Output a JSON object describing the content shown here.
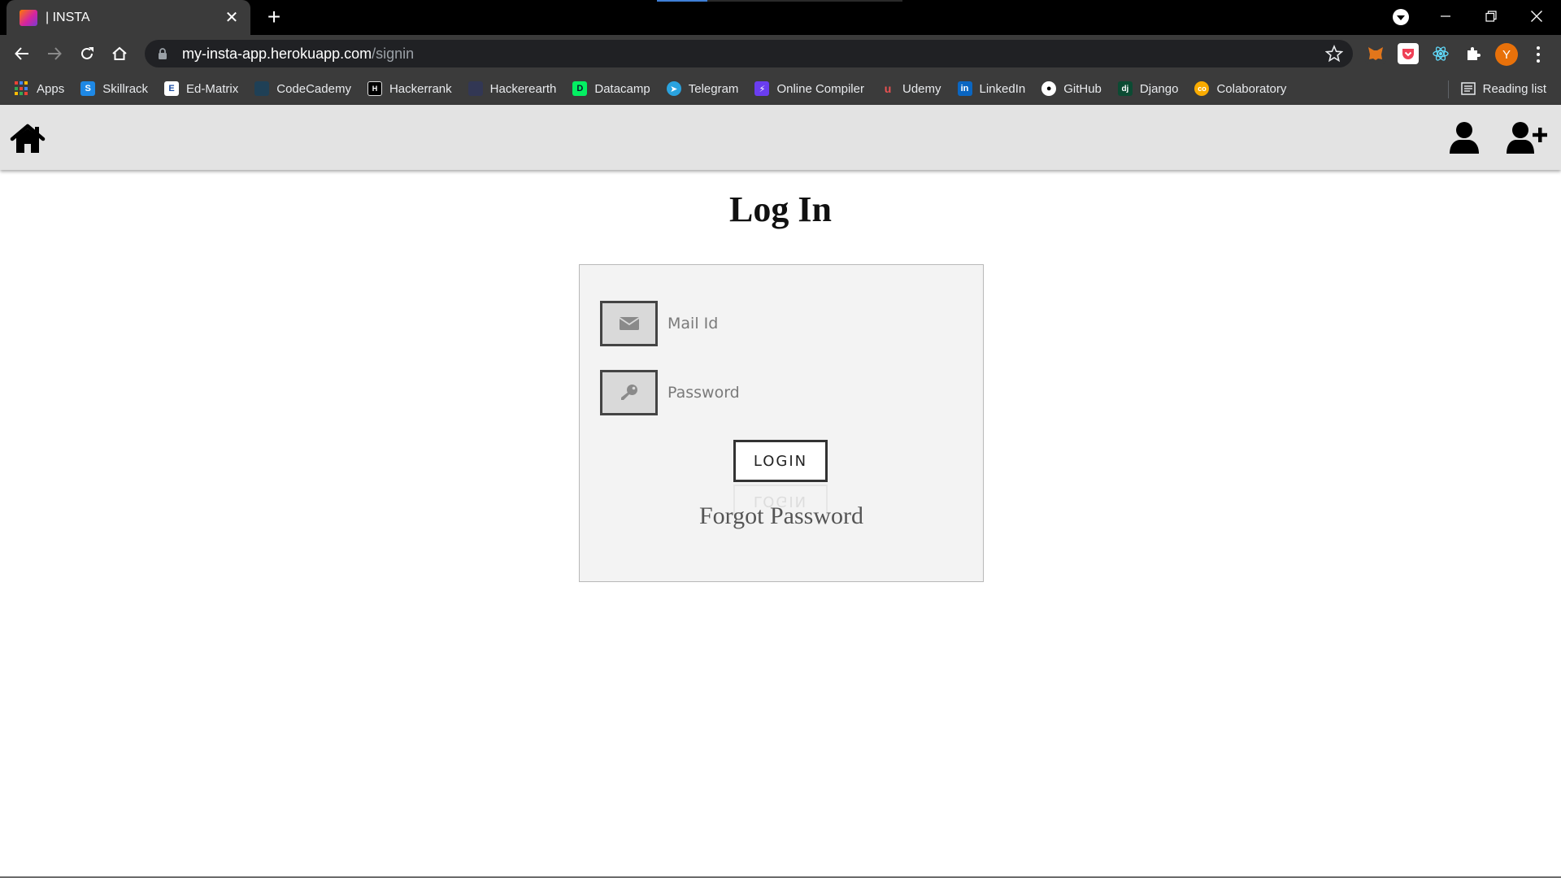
{
  "browser": {
    "tab_title": "|  INSTA",
    "new_tab_label": "+",
    "url_host": "my-insta-app.herokuapp.com",
    "url_path": "/signin",
    "avatar_letter": "Y",
    "reading_list_label": "Reading list",
    "icons": [
      "back-arrow-icon",
      "forward-arrow-icon",
      "reload-icon",
      "home-icon",
      "lock-icon",
      "star-icon",
      "extensions-icon",
      "menu-icon"
    ]
  },
  "bookmarks": [
    {
      "label": "Apps",
      "icon": "apps-grid-icon",
      "color": "#4285f4"
    },
    {
      "label": "Skillrack",
      "icon": "skillrack-icon",
      "color": "#1e88e5"
    },
    {
      "label": "Ed-Matrix",
      "icon": "edmatrix-icon",
      "color": "#ffffff"
    },
    {
      "label": "CodeCademy",
      "icon": "codecademy-icon",
      "color": "#1f4056"
    },
    {
      "label": "Hackerrank",
      "icon": "hackerrank-icon",
      "color": "#000000"
    },
    {
      "label": "Hackerearth",
      "icon": "hackerearth-icon",
      "color": "#323754"
    },
    {
      "label": "Datacamp",
      "icon": "datacamp-icon",
      "color": "#03ef62"
    },
    {
      "label": "Telegram",
      "icon": "telegram-icon",
      "color": "#2aa3df"
    },
    {
      "label": "Online Compiler",
      "icon": "compiler-icon",
      "color": "#6a3df0"
    },
    {
      "label": "Udemy",
      "icon": "udemy-icon",
      "color": "#ec5252"
    },
    {
      "label": "LinkedIn",
      "icon": "linkedin-icon",
      "color": "#0a66c2"
    },
    {
      "label": "GitHub",
      "icon": "github-icon",
      "color": "#ffffff"
    },
    {
      "label": "Django",
      "icon": "django-icon",
      "color": "#0c4b33"
    },
    {
      "label": "Colaboratory",
      "icon": "colab-icon",
      "color": "#f9ab00"
    }
  ],
  "page": {
    "title": "Log In",
    "email_placeholder": "Mail Id",
    "password_placeholder": "Password",
    "login_label": "LOGIN",
    "forgot_label": "Forgot Password",
    "icons": [
      "home-icon",
      "user-icon",
      "add-user-icon",
      "envelope-icon",
      "key-icon"
    ]
  },
  "colors": {
    "navbar_bg": "#e3e3e3",
    "card_bg": "#f3f3f3",
    "chrome_bg": "#3b3b3b"
  }
}
